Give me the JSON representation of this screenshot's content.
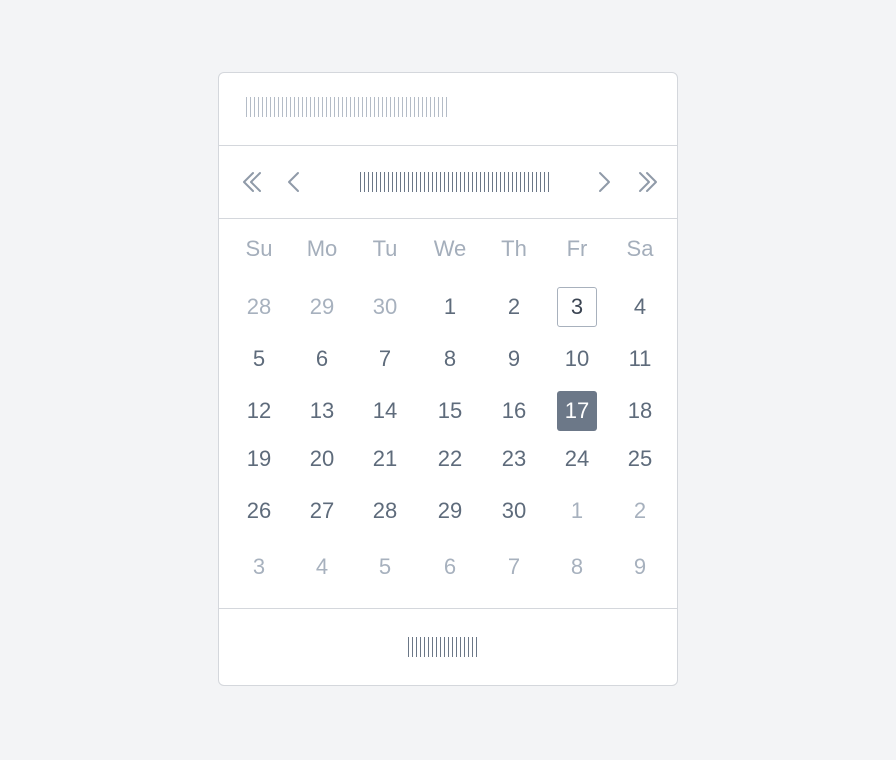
{
  "colors": {
    "accent": "#6c7888",
    "border": "#d4d7dc",
    "text": "#5e6b7b",
    "muted": "#a7b1be"
  },
  "input": {
    "placeholder": ""
  },
  "header": {
    "month_year": ""
  },
  "footer": {
    "today_label": ""
  },
  "icons": {
    "prev_year": "double-chevron-left-icon",
    "prev_month": "chevron-left-icon",
    "next_month": "chevron-right-icon",
    "next_year": "double-chevron-right-icon"
  },
  "calendar": {
    "weekdays": [
      "Su",
      "Mo",
      "Tu",
      "We",
      "Th",
      "Fr",
      "Sa"
    ],
    "weeks": [
      [
        {
          "d": "28",
          "m": true
        },
        {
          "d": "29",
          "m": true
        },
        {
          "d": "30",
          "m": true
        },
        {
          "d": "1"
        },
        {
          "d": "2"
        },
        {
          "d": "3",
          "today": true
        },
        {
          "d": "4"
        }
      ],
      [
        {
          "d": "5"
        },
        {
          "d": "6"
        },
        {
          "d": "7"
        },
        {
          "d": "8"
        },
        {
          "d": "9"
        },
        {
          "d": "10"
        },
        {
          "d": "11"
        }
      ],
      [
        {
          "d": "12"
        },
        {
          "d": "13"
        },
        {
          "d": "14"
        },
        {
          "d": "15"
        },
        {
          "d": "16"
        },
        {
          "d": "17",
          "selected": true
        },
        {
          "d": "18"
        }
      ],
      [
        {
          "d": "19"
        },
        {
          "d": "20"
        },
        {
          "d": "21"
        },
        {
          "d": "22"
        },
        {
          "d": "23"
        },
        {
          "d": "24"
        },
        {
          "d": "25"
        }
      ],
      [
        {
          "d": "26"
        },
        {
          "d": "27"
        },
        {
          "d": "28"
        },
        {
          "d": "29"
        },
        {
          "d": "30"
        },
        {
          "d": "1",
          "m": true
        },
        {
          "d": "2",
          "m": true
        }
      ],
      [
        {
          "d": "3",
          "m": true
        },
        {
          "d": "4",
          "m": true
        },
        {
          "d": "5",
          "m": true
        },
        {
          "d": "6",
          "m": true
        },
        {
          "d": "7",
          "m": true
        },
        {
          "d": "8",
          "m": true
        },
        {
          "d": "9",
          "m": true
        }
      ]
    ]
  }
}
